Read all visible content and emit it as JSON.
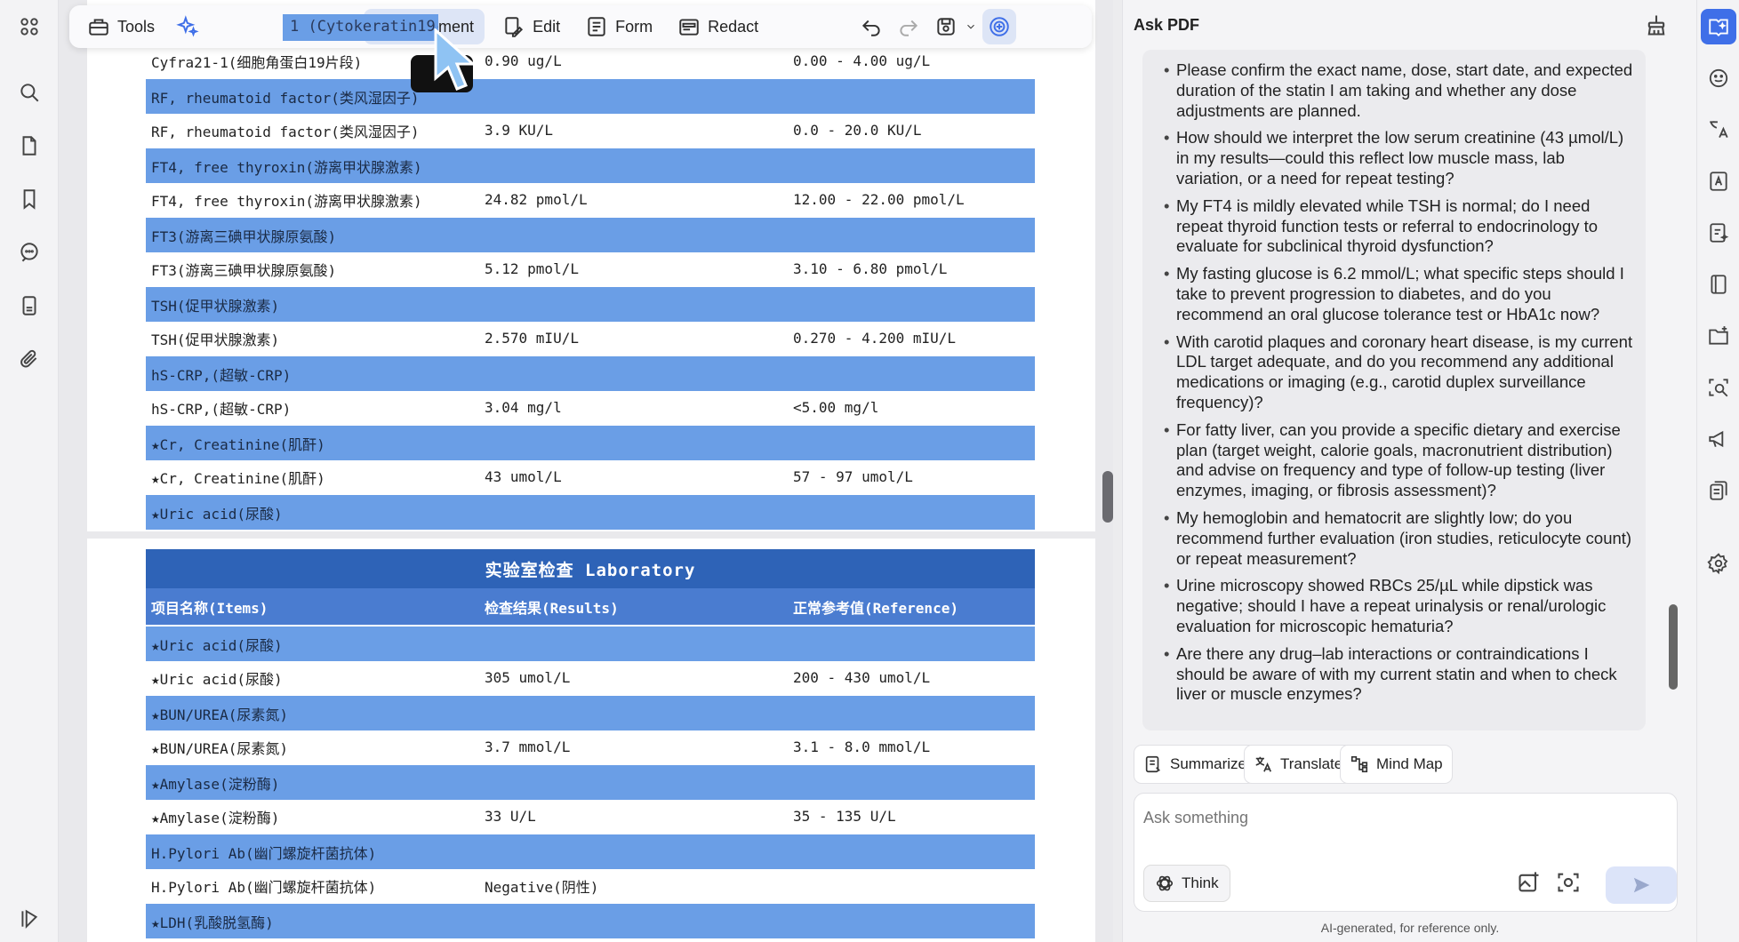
{
  "toolbar": {
    "tools_label": "Tools",
    "search_text": "1 (Cytokeratin19-fra",
    "comment_label": "Comment",
    "edit_label": "Edit",
    "form_label": "Form",
    "redact_label": "Redact"
  },
  "page1": {
    "rows": [
      {
        "type": "item",
        "name": "Cyfra21-1(细胞角蛋白19片段)",
        "result": "0.90 ug/L",
        "reference": "0.00 - 4.00 ug/L",
        "abnormal": false
      },
      {
        "type": "group",
        "name": "RF, rheumatoid factor(类风湿因子)"
      },
      {
        "type": "item",
        "name": "RF, rheumatoid factor(类风湿因子)",
        "result": "3.9 KU/L",
        "reference": "0.0 - 20.0 KU/L",
        "abnormal": false
      },
      {
        "type": "group",
        "name": "FT4, free thyroxin(游离甲状腺激素)"
      },
      {
        "type": "item",
        "name": "FT4, free thyroxin(游离甲状腺激素)",
        "result": "24.82 pmol/L",
        "reference": "12.00 - 22.00 pmol/L",
        "abnormal": true
      },
      {
        "type": "group",
        "name": "FT3(游离三碘甲状腺原氨酸)"
      },
      {
        "type": "item",
        "name": "FT3(游离三碘甲状腺原氨酸)",
        "result": "5.12 pmol/L",
        "reference": "3.10 - 6.80 pmol/L",
        "abnormal": false
      },
      {
        "type": "group",
        "name": "TSH(促甲状腺激素)"
      },
      {
        "type": "item",
        "name": "TSH(促甲状腺激素)",
        "result": "2.570 mIU/L",
        "reference": "0.270 - 4.200 mIU/L",
        "abnormal": false
      },
      {
        "type": "group",
        "name": "hS-CRP,(超敏-CRP)"
      },
      {
        "type": "item",
        "name": "hS-CRP,(超敏-CRP)",
        "result": "3.04 mg/l",
        "reference": "<5.00 mg/l",
        "abnormal": false
      },
      {
        "type": "group",
        "name": "★Cr, Creatinine(肌酐)"
      },
      {
        "type": "item",
        "name": "★Cr, Creatinine(肌酐)",
        "result": "43 umol/L",
        "reference": "57 - 97 umol/L",
        "abnormal": true
      },
      {
        "type": "group",
        "name": "★Uric acid(尿酸)"
      }
    ]
  },
  "page2": {
    "title": "实验室检查 Laboratory",
    "col_items": "项目名称(Items)",
    "col_results": "检查结果(Results)",
    "col_reference": "正常参考值(Reference)",
    "rows": [
      {
        "type": "group",
        "name": "★Uric acid(尿酸)"
      },
      {
        "type": "item",
        "name": "★Uric acid(尿酸)",
        "result": "305 umol/L",
        "reference": "200 - 430 umol/L",
        "abnormal": false
      },
      {
        "type": "group",
        "name": "★BUN/UREA(尿素氮)"
      },
      {
        "type": "item",
        "name": "★BUN/UREA(尿素氮)",
        "result": "3.7 mmol/L",
        "reference": "3.1 - 8.0 mmol/L",
        "abnormal": false
      },
      {
        "type": "group",
        "name": "★Amylase(淀粉酶)"
      },
      {
        "type": "item",
        "name": "★Amylase(淀粉酶)",
        "result": "33 U/L",
        "reference": "35 - 135 U/L",
        "abnormal": true
      },
      {
        "type": "group",
        "name": "H.Pylori Ab(幽门螺旋杆菌抗体)"
      },
      {
        "type": "item",
        "name": "H.Pylori Ab(幽门螺旋杆菌抗体)",
        "result": "Negative(阴性)",
        "reference": "",
        "abnormal": false
      },
      {
        "type": "group",
        "name": "★LDH(乳酸脱氢酶)"
      }
    ]
  },
  "ask": {
    "title": "Ask PDF",
    "questions": [
      "Please confirm the exact name, dose, start date, and expected duration of the statin I am taking and whether any dose adjustments are planned.",
      "How should we interpret the low serum creatinine (43 µmol/L) in my results—could this reflect low muscle mass, lab variation, or a need for repeat testing?",
      "My FT4 is mildly elevated while TSH is normal; do I need repeat thyroid function tests or referral to endocrinology to evaluate for subclinical thyroid dysfunction?",
      "My fasting glucose is 6.2 mmol/L; what specific steps should I take to prevent progression to diabetes, and do you recommend an oral glucose tolerance test or HbA1c now?",
      "With carotid plaques and coronary heart disease, is my current LDL target adequate, and do you recommend any additional medications or imaging (e.g., carotid duplex surveillance frequency)?",
      "For fatty liver, can you provide a specific dietary and exercise plan (target weight, calorie goals, macronutrient distribution) and advise on frequency and type of follow-up testing (liver enzymes, imaging, or fibrosis assessment)?",
      "My hemoglobin and hematocrit are slightly low; do you recommend further evaluation (iron studies, reticulocyte count) or repeat measurement?",
      "Urine microscopy showed RBCs 25/µL while dipstick was negative; should I have a repeat urinalysis or renal/urologic evaluation for microscopic hematuria?",
      "Are there any drug–lab interactions or contraindications I should be aware of with my current statin and when to check liver or muscle enzymes?"
    ],
    "summarize_label": "Summarize",
    "translate_label": "Translate",
    "mindmap_label": "Mind Map",
    "input_placeholder": "Ask something",
    "think_label": "Think",
    "disclaimer": "AI-generated, for reference only."
  },
  "colors": {
    "group_row": "#6a9ee6",
    "header_dark": "#2e63b7",
    "abnormal": "#e8261f",
    "accent": "#3f6fe8"
  }
}
